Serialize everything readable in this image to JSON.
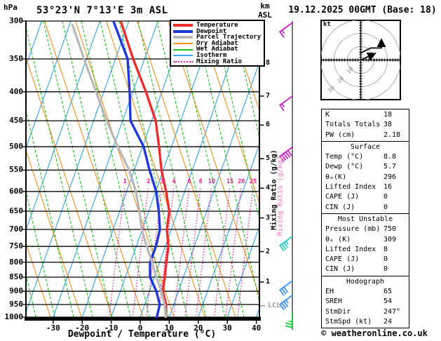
{
  "header": {
    "pressure_axis_unit": "hPa",
    "station_title": "53°23'N 7°13'E 3m ASL",
    "altitude_axis_unit": "km\nASL",
    "run_datetime": "19.12.2025 00GMT (Base: 18)"
  },
  "legend": {
    "items": [
      {
        "label": "Temperature",
        "color_key": "temperature",
        "thick": true,
        "dash": "solid"
      },
      {
        "label": "Dewpoint",
        "color_key": "dewpoint",
        "thick": true,
        "dash": "solid"
      },
      {
        "label": "Parcel Trajectory",
        "color_key": "parcel",
        "thick": true,
        "dash": "solid"
      },
      {
        "label": "Dry Adiabat",
        "color_key": "dry_adiabat",
        "thick": false,
        "dash": "solid"
      },
      {
        "label": "Wet Adiabat",
        "color_key": "wet_adiabat",
        "thick": false,
        "dash": "solid"
      },
      {
        "label": "Isotherm",
        "color_key": "isotherm",
        "thick": false,
        "dash": "solid"
      },
      {
        "label": "Mixing Ratio",
        "color_key": "mixing_ratio",
        "thick": false,
        "dash": "dotted"
      }
    ]
  },
  "chart_data": {
    "type": "line",
    "variant": "skew-t-log-p",
    "title": "53°23'N 7°13'E 3m ASL",
    "xlabel": "Dewpoint / Temperature (°C)",
    "x_ticks_c": [
      -30,
      -20,
      -10,
      0,
      10,
      20,
      30,
      40
    ],
    "x_range_c": [
      -39,
      41
    ],
    "pressure_ticks_hpa": [
      300,
      350,
      400,
      450,
      500,
      550,
      600,
      650,
      700,
      750,
      800,
      850,
      900,
      950,
      1000
    ],
    "pressure_range_hpa": [
      300,
      1000
    ],
    "isotherm_step_c": 10,
    "km_asl_ticks": [
      {
        "label": "8",
        "hpa": 356
      },
      {
        "label": "7",
        "hpa": 407
      },
      {
        "label": "6",
        "hpa": 458
      },
      {
        "label": "5",
        "hpa": 525
      },
      {
        "label": "4",
        "hpa": 592
      },
      {
        "label": "3",
        "hpa": 668
      },
      {
        "label": "2",
        "hpa": 766
      },
      {
        "label": "1",
        "hpa": 867
      }
    ],
    "lcl": {
      "label": "LCL",
      "hpa": 955
    },
    "mixing_ratio": {
      "axis_label": "Mixing Ratio (g/kg)",
      "values_g_kg": [
        1,
        2,
        3,
        4,
        6,
        8,
        10,
        15,
        20,
        25
      ],
      "label_row_hpa": 586,
      "label_temps_c": [
        -21.3,
        -13.2,
        -8.5,
        -4.4,
        0.9,
        4.8,
        8.6,
        14.9,
        18.8,
        22.9
      ]
    },
    "series": [
      {
        "name": "Temperature",
        "color_key": "temperature",
        "width": 3.4,
        "points_p_t": [
          [
            300,
            -42.8
          ],
          [
            350,
            -33.9
          ],
          [
            400,
            -25.5
          ],
          [
            450,
            -18.6
          ],
          [
            500,
            -14.3
          ],
          [
            550,
            -10.6
          ],
          [
            600,
            -6.4
          ],
          [
            650,
            -2.9
          ],
          [
            700,
            -1.5
          ],
          [
            750,
            1.1
          ],
          [
            800,
            2.3
          ],
          [
            850,
            3.6
          ],
          [
            900,
            4.6
          ],
          [
            950,
            7.4
          ],
          [
            1000,
            8.8
          ]
        ]
      },
      {
        "name": "Dewpoint",
        "color_key": "dewpoint",
        "width": 3.4,
        "points_p_t": [
          [
            300,
            -45.3
          ],
          [
            350,
            -35.8
          ],
          [
            400,
            -31.1
          ],
          [
            450,
            -27.3
          ],
          [
            500,
            -19.6
          ],
          [
            550,
            -14.7
          ],
          [
            600,
            -9.8
          ],
          [
            650,
            -6.5
          ],
          [
            700,
            -3.9
          ],
          [
            750,
            -3.2
          ],
          [
            800,
            -3.3
          ],
          [
            850,
            -1.5
          ],
          [
            900,
            2.4
          ],
          [
            950,
            5.2
          ],
          [
            1000,
            5.7
          ]
        ]
      },
      {
        "name": "Parcel Trajectory",
        "color_key": "parcel",
        "width": 3.2,
        "points_p_t": [
          [
            305,
            -58.9
          ],
          [
            350,
            -50.8
          ],
          [
            400,
            -42.7
          ],
          [
            450,
            -35.5
          ],
          [
            500,
            -28.5
          ],
          [
            550,
            -21.7
          ],
          [
            600,
            -16.8
          ],
          [
            650,
            -13.2
          ],
          [
            700,
            -10.2
          ],
          [
            750,
            -6.4
          ],
          [
            800,
            -2.6
          ],
          [
            850,
            0.7
          ],
          [
            900,
            4.1
          ],
          [
            950,
            6.9
          ],
          [
            1000,
            8.8
          ]
        ]
      }
    ],
    "wind_barbs": [
      {
        "hpa": 302,
        "speed_kt": 15,
        "color_key": "barb_upper"
      },
      {
        "hpa": 407,
        "speed_kt": 15,
        "color_key": "barb_upper"
      },
      {
        "hpa": 501,
        "speed_kt": 50,
        "color_key": "barb_upper"
      },
      {
        "hpa": 720,
        "speed_kt": 35,
        "color_key": "barb_mid"
      },
      {
        "hpa": 863,
        "speed_kt": 30,
        "color_key": "barb_low"
      },
      {
        "hpa": 915,
        "speed_kt": 35,
        "color_key": "barb_low"
      },
      {
        "hpa": "surface",
        "speed_kt": 25,
        "color_key": "barb_sfc"
      }
    ]
  },
  "hodograph": {
    "unit_label": "kt",
    "ring_step_kt": 10,
    "ring_labels": [
      "10",
      "20",
      "30"
    ],
    "traces_kt": [
      [
        [
          0,
          0
        ],
        [
          10,
          4.5
        ]
      ],
      [
        [
          -0.5,
          5
        ],
        [
          7.5,
          9
        ],
        [
          15.5,
          9
        ],
        [
          15.5,
          14.5
        ]
      ]
    ]
  },
  "stats_table": {
    "sections": [
      {
        "header": null,
        "rows": [
          [
            "K",
            "18"
          ],
          [
            "Totals Totals",
            "38"
          ],
          [
            "PW (cm)",
            "2.18"
          ]
        ]
      },
      {
        "header": "Surface",
        "rows": [
          [
            "Temp (°C)",
            "8.8"
          ],
          [
            "Dewp (°C)",
            "5.7"
          ],
          [
            "θₑ(K)",
            "296"
          ],
          [
            "Lifted Index",
            "16"
          ],
          [
            "CAPE (J)",
            "0"
          ],
          [
            "CIN (J)",
            "0"
          ]
        ]
      },
      {
        "header": "Most Unstable",
        "rows": [
          [
            "Pressure (mb)",
            "750"
          ],
          [
            "θₑ (K)",
            "309"
          ],
          [
            "Lifted Index",
            "8"
          ],
          [
            "CAPE (J)",
            "0"
          ],
          [
            "CIN (J)",
            "0"
          ]
        ]
      },
      {
        "header": "Hodograph",
        "rows": [
          [
            "EH",
            "65"
          ],
          [
            "SREH",
            "54"
          ],
          [
            "StmDir",
            "247°"
          ],
          [
            "StmSpd (kt)",
            "24"
          ]
        ]
      }
    ]
  },
  "footer": {
    "copyright": "© weatheronline.co.uk"
  },
  "palette": {
    "temperature": "#ee2c2c",
    "dewpoint": "#2137dd",
    "parcel": "#b8b8b8",
    "dry_adiabat": "#ff8c1a",
    "wet_adiabat": "#1fc41f",
    "isotherm": "#3fa8f5",
    "mixing_ratio": "#f5198c",
    "barb_upper": "#c816c8",
    "barb_mid": "#22cfc4",
    "barb_low": "#2e8cff",
    "barb_sfc": "#17c837",
    "grid": "#000000",
    "staff": "#777777",
    "hodo_ring": "#aaaaaa",
    "muted": "#999999"
  }
}
